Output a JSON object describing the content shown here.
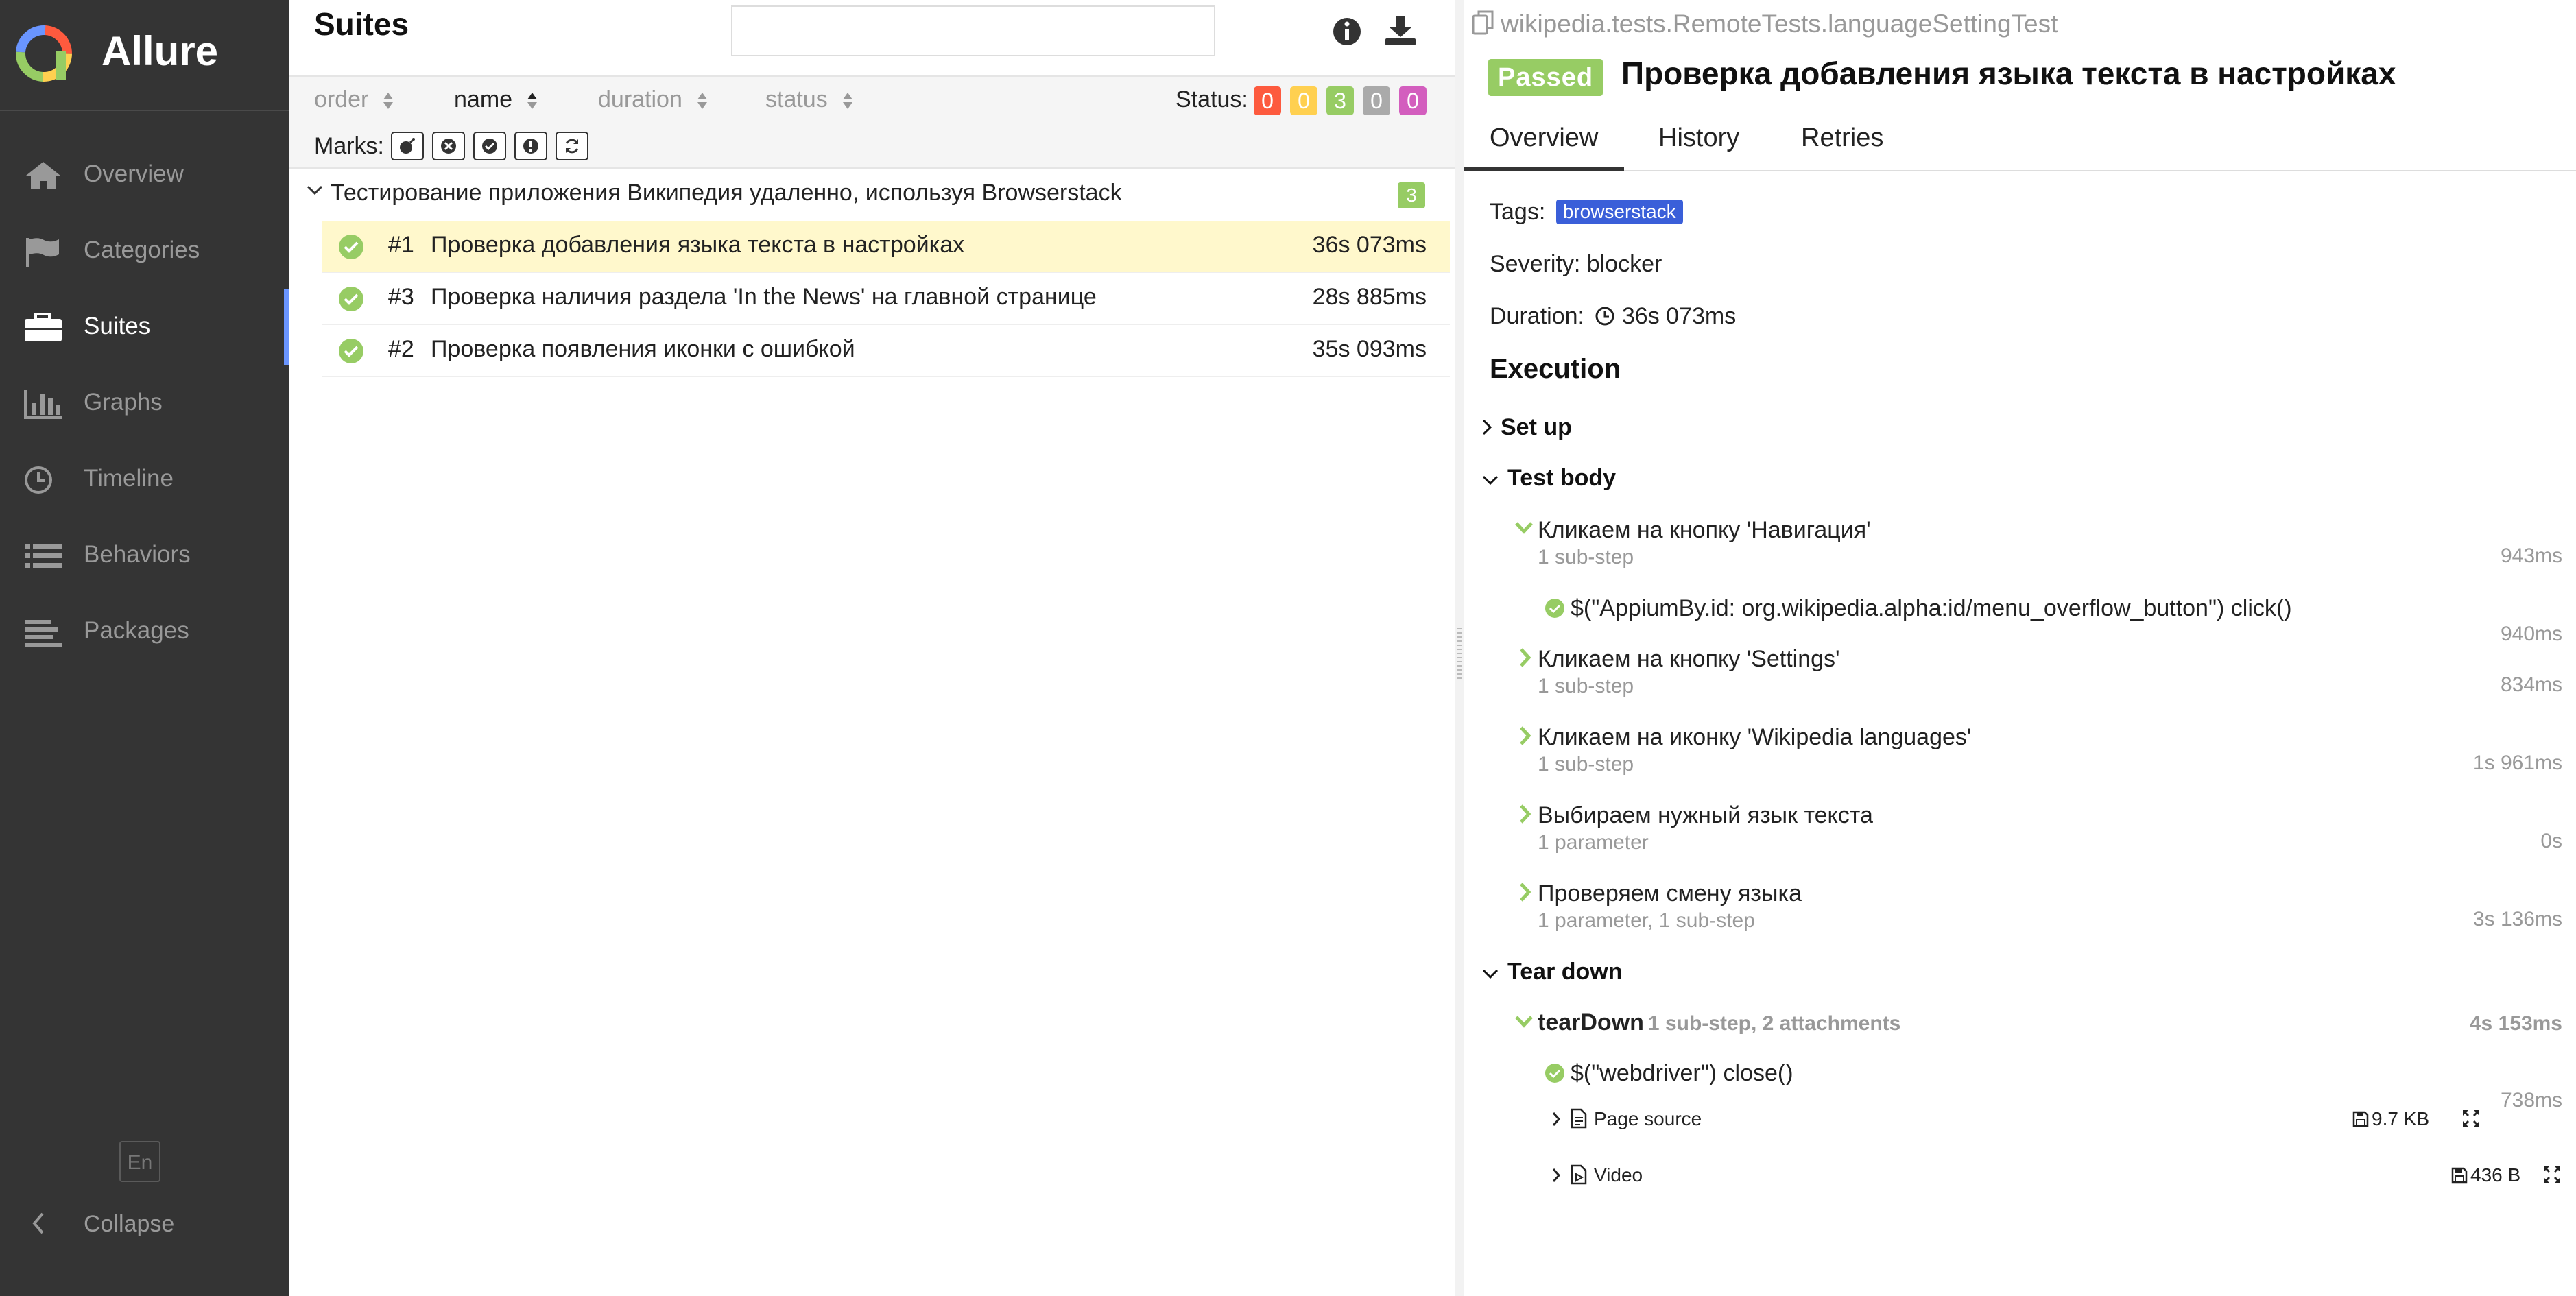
{
  "sidebar": {
    "brand": "Allure",
    "items": [
      {
        "label": "Overview",
        "icon": "home-icon"
      },
      {
        "label": "Categories",
        "icon": "flag-icon"
      },
      {
        "label": "Suites",
        "icon": "briefcase-icon",
        "active": true
      },
      {
        "label": "Graphs",
        "icon": "bar-chart-icon"
      },
      {
        "label": "Timeline",
        "icon": "clock-icon"
      },
      {
        "label": "Behaviors",
        "icon": "list-icon"
      },
      {
        "label": "Packages",
        "icon": "align-left-icon"
      }
    ],
    "language": "En",
    "collapse_label": "Collapse"
  },
  "suites": {
    "title": "Suites",
    "search": {
      "value": "",
      "placeholder": ""
    },
    "sort": [
      "order",
      "name",
      "duration",
      "status"
    ],
    "sort_active": "name",
    "status_label": "Status:",
    "status_counts": [
      {
        "value": "0",
        "color": "#fd5a3e"
      },
      {
        "value": "0",
        "color": "#ffd050"
      },
      {
        "value": "3",
        "color": "#97cc64"
      },
      {
        "value": "0",
        "color": "#aaaaaa"
      },
      {
        "value": "0",
        "color": "#d35ebe"
      }
    ],
    "marks_label": "Marks:",
    "group": {
      "name": "Тестирование приложения Википедия удаленно, используя Browserstack",
      "count": "3"
    },
    "tests": [
      {
        "num": "#1",
        "name": "Проверка добавления языка текста в настройках",
        "duration": "36s 073ms",
        "selected": true
      },
      {
        "num": "#3",
        "name": "Проверка наличия раздела 'In the News' на главной странице",
        "duration": "28s 885ms"
      },
      {
        "num": "#2",
        "name": "Проверка появления иконки с ошибкой",
        "duration": "35s 093ms"
      }
    ]
  },
  "detail": {
    "breadcrumb": "wikipedia.tests.RemoteTests.languageSettingTest",
    "status_badge": "Passed",
    "title": "Проверка добавления языка текста в настройках",
    "tabs": [
      "Overview",
      "History",
      "Retries"
    ],
    "tags_label": "Tags:",
    "tag": "browserstack",
    "severity": "Severity: blocker",
    "duration_label": "Duration:",
    "duration": "36s 073ms",
    "execution_title": "Execution",
    "setup_label": "Set up",
    "body_label": "Test body",
    "steps": [
      {
        "name": "Кликаем на кнопку 'Навигация'",
        "sub": "1 sub-step",
        "duration": "943ms",
        "expanded": true
      },
      {
        "name": "$(\"AppiumBy.id: org.wikipedia.alpha:id/menu_overflow_button\") click()",
        "duration": "940ms"
      },
      {
        "name": "Кликаем на кнопку 'Settings'",
        "sub": "1 sub-step",
        "duration": "834ms"
      },
      {
        "name": "Кликаем на иконку 'Wikipedia languages'",
        "sub": "1 sub-step",
        "duration": "1s 961ms"
      },
      {
        "name": "Выбираем нужный язык текста",
        "sub": "1 parameter",
        "duration": "0s"
      },
      {
        "name": "Проверяем смену языка",
        "sub": "1 parameter, 1 sub-step",
        "duration": "3s 136ms"
      }
    ],
    "teardown_label": "Tear down",
    "teardown": {
      "name": "tearDown",
      "meta": "1 sub-step, 2 attachments",
      "duration": "4s 153ms",
      "substep": "$(\"webdriver\") close()",
      "substep_duration": "738ms",
      "attachments": [
        {
          "name": "Page source",
          "size": "9.7 KB"
        },
        {
          "name": "Video",
          "size": "436 B"
        }
      ]
    }
  }
}
